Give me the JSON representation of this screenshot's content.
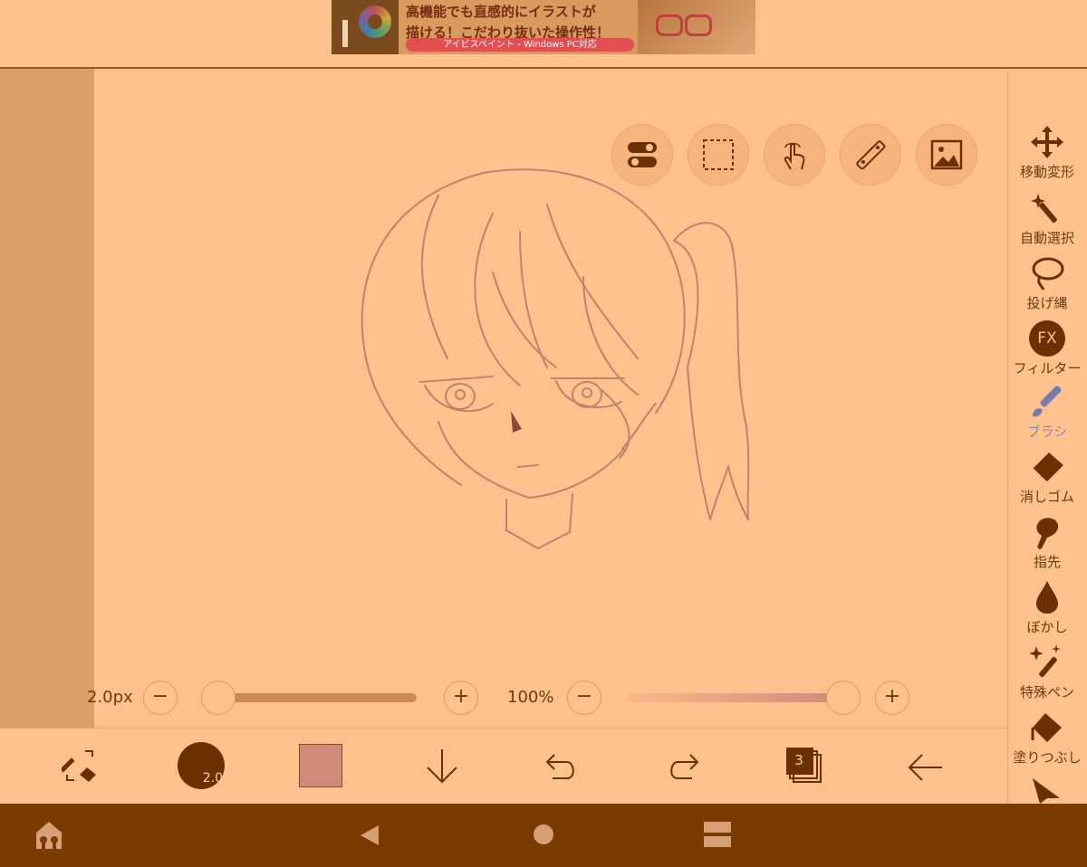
{
  "ad": {
    "line1": "高機能でも直感的にイラストが",
    "line2": "描ける！こだわり抜いた操作性！",
    "line3": "アイビスペイント - Windows PC対応"
  },
  "brush": {
    "size_label": "2.0px",
    "size_badge": "2.0",
    "opacity_label": "100%",
    "size_fraction": 0.05,
    "opacity_fraction": 1.0,
    "color": "#CF8A7A"
  },
  "controls": {
    "minus": "−",
    "plus": "+"
  },
  "layers": {
    "count": "3"
  },
  "tools": [
    {
      "label": "移動変形",
      "icon": "move-icon"
    },
    {
      "label": "自動選択",
      "icon": "magic-wand-icon"
    },
    {
      "label": "投げ縄",
      "icon": "lasso-icon"
    },
    {
      "label": "フィルター",
      "icon": "fx-icon"
    },
    {
      "label": "ブラシ",
      "icon": "brush-icon"
    },
    {
      "label": "消しゴム",
      "icon": "eraser-icon"
    },
    {
      "label": "指先",
      "icon": "finger-icon"
    },
    {
      "label": "ぼかし",
      "icon": "blur-drop-icon"
    },
    {
      "label": "特殊ペン",
      "icon": "special-pen-icon"
    },
    {
      "label": "塗りつぶし",
      "icon": "fill-bucket-icon"
    }
  ],
  "fx_text": "FX",
  "colors": {
    "background": "#FFC28F",
    "side_panel": "#D9A06B",
    "nav_bar": "#7B3A00",
    "line": "#C0826C"
  }
}
